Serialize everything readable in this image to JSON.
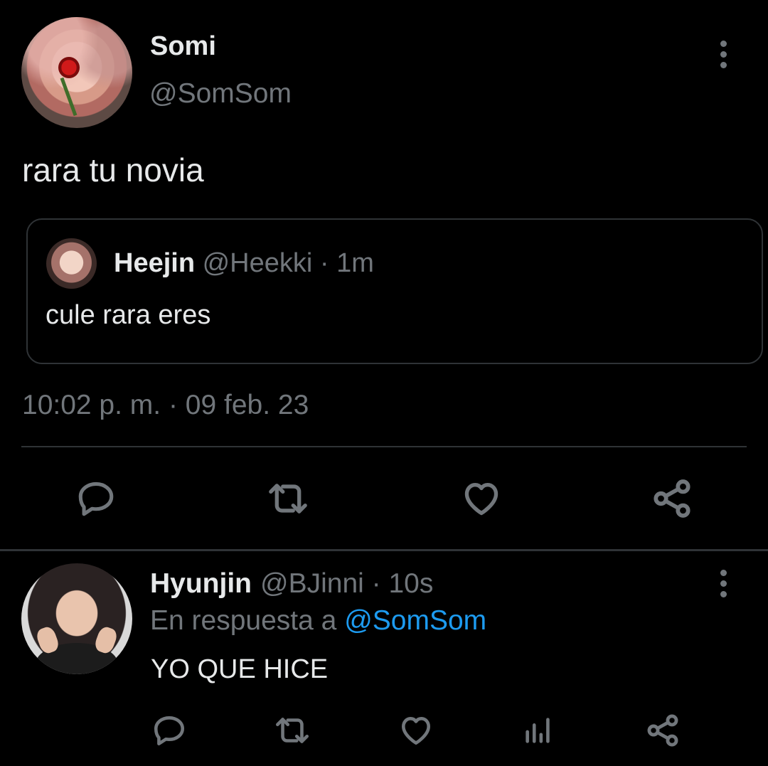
{
  "main_tweet": {
    "display_name": "Somi",
    "handle": "@SomSom",
    "text": "rara tu novia",
    "timestamp": "10:02 p. m. · 09 feb. 23",
    "quoted": {
      "display_name": "Heejin",
      "meta": "@Heekki · 1m",
      "text": "cule rara eres"
    },
    "actions": [
      "reply-icon",
      "retweet-icon",
      "like-icon",
      "share-icon"
    ]
  },
  "reply_tweet": {
    "display_name": "Hyunjin",
    "meta": "@BJinni · 10s",
    "replying_prefix": "En respuesta a",
    "replying_to": "@SomSom",
    "text": "YO QUE HICE",
    "actions": [
      "reply-icon",
      "retweet-icon",
      "like-icon",
      "analytics-icon",
      "share-icon"
    ]
  },
  "colors": {
    "background": "#000000",
    "text_primary": "#e7e9ea",
    "text_secondary": "#71767b",
    "accent": "#1d9bf0",
    "border": "#2f3336"
  }
}
